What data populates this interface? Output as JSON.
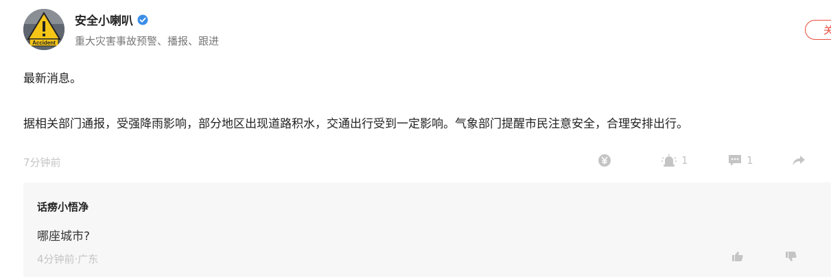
{
  "author": {
    "name": "安全小喇叭",
    "description": "重大灾害事故预警、播报、跟进",
    "avatar_text": "Accident",
    "verified_color": "#3b8ee8"
  },
  "follow_button": {
    "label": "关注"
  },
  "post": {
    "line1": "最新消息。",
    "line2": "据相关部门通报，受强降雨影响，部分地区出现道路积水，交通出行受到一定影响。气象部门提醒市民注意安全，合理安排出行。",
    "time": "7分钟前",
    "actions": {
      "reward_icon": "yen-coin-icon",
      "like_count": "1",
      "comment_count": "1",
      "share_icon": "share-arrow-icon"
    }
  },
  "comment": {
    "author": "话痨小悟净",
    "text": "哪座城市?",
    "meta": "4分钟前·广东"
  },
  "colors": {
    "accent": "#e74c3c",
    "muted": "#c4c4c4",
    "comment_bg": "#f7f7f7"
  }
}
